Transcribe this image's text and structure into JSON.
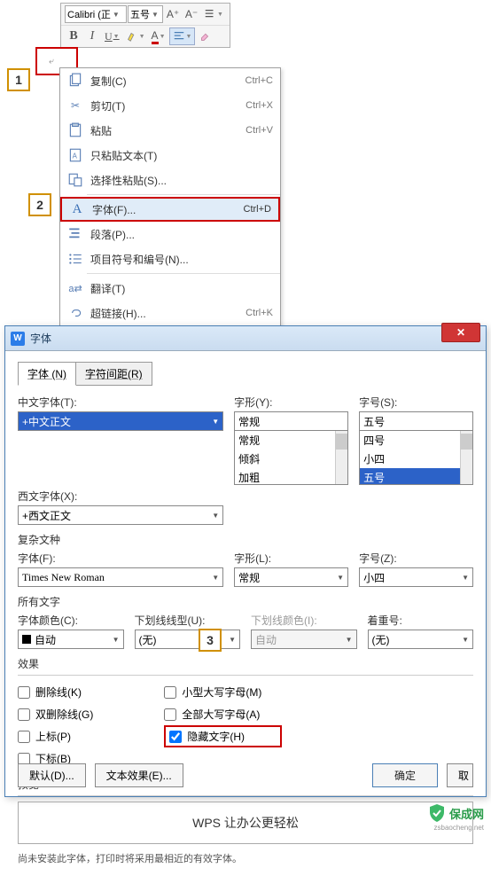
{
  "toolbar": {
    "font_name": "Calibri (正",
    "font_size": "五号",
    "increase": "A⁺",
    "decrease": "A⁻"
  },
  "steps": {
    "s1": "1",
    "s2": "2",
    "s3": "3"
  },
  "ctx": {
    "copy": "复制(C)",
    "copy_k": "Ctrl+C",
    "cut": "剪切(T)",
    "cut_k": "Ctrl+X",
    "paste": "粘贴",
    "paste_k": "Ctrl+V",
    "paste_text": "只粘贴文本(T)",
    "paste_special": "选择性粘贴(S)...",
    "font": "字体(F)...",
    "font_k": "Ctrl+D",
    "para": "段落(P)...",
    "bullets": "项目符号和编号(N)...",
    "translate": "翻译(T)",
    "hyperlink": "超链接(H)...",
    "hyperlink_k": "Ctrl+K"
  },
  "dialog": {
    "title": "字体",
    "tab1": "字体 (N)",
    "tab2": "字符间距(R)",
    "cn_font_lbl": "中文字体(T):",
    "cn_font_val": "+中文正文",
    "style_lbl": "字形(Y):",
    "style_val": "常规",
    "style_opts": [
      "常规",
      "倾斜",
      "加粗"
    ],
    "size_lbl": "字号(S):",
    "size_val": "五号",
    "size_opts": [
      "四号",
      "小四",
      "五号"
    ],
    "en_font_lbl": "西文字体(X):",
    "en_font_val": "+西文正文",
    "complex_section": "复杂文种",
    "c_font_lbl": "字体(F):",
    "c_font_val": "Times New Roman",
    "c_style_lbl": "字形(L):",
    "c_style_val": "常规",
    "c_size_lbl": "字号(Z):",
    "c_size_val": "小四",
    "all_text": "所有文字",
    "color_lbl": "字体颜色(C):",
    "color_val": "自动",
    "und_lbl": "下划线线型(U):",
    "und_val": "(无)",
    "und_color_lbl": "下划线颜色(I):",
    "und_color_val": "自动",
    "emph_lbl": "着重号:",
    "emph_val": "(无)",
    "effects": "效果",
    "strike": "删除线(K)",
    "dstrike": "双删除线(G)",
    "super": "上标(P)",
    "sub": "下标(B)",
    "smallcaps": "小型大写字母(M)",
    "allcaps": "全部大写字母(A)",
    "hidden": "隐藏文字(H)",
    "preview_lbl": "预览",
    "preview_text": "WPS 让办公更轻松",
    "hint": "尚未安装此字体，打印时将采用最相近的有效字体。",
    "default_btn": "默认(D)...",
    "text_effect_btn": "文本效果(E)...",
    "ok": "确定",
    "cancel": "取"
  },
  "watermark": {
    "brand": "保成网",
    "url": "zsbaocheng.net"
  }
}
